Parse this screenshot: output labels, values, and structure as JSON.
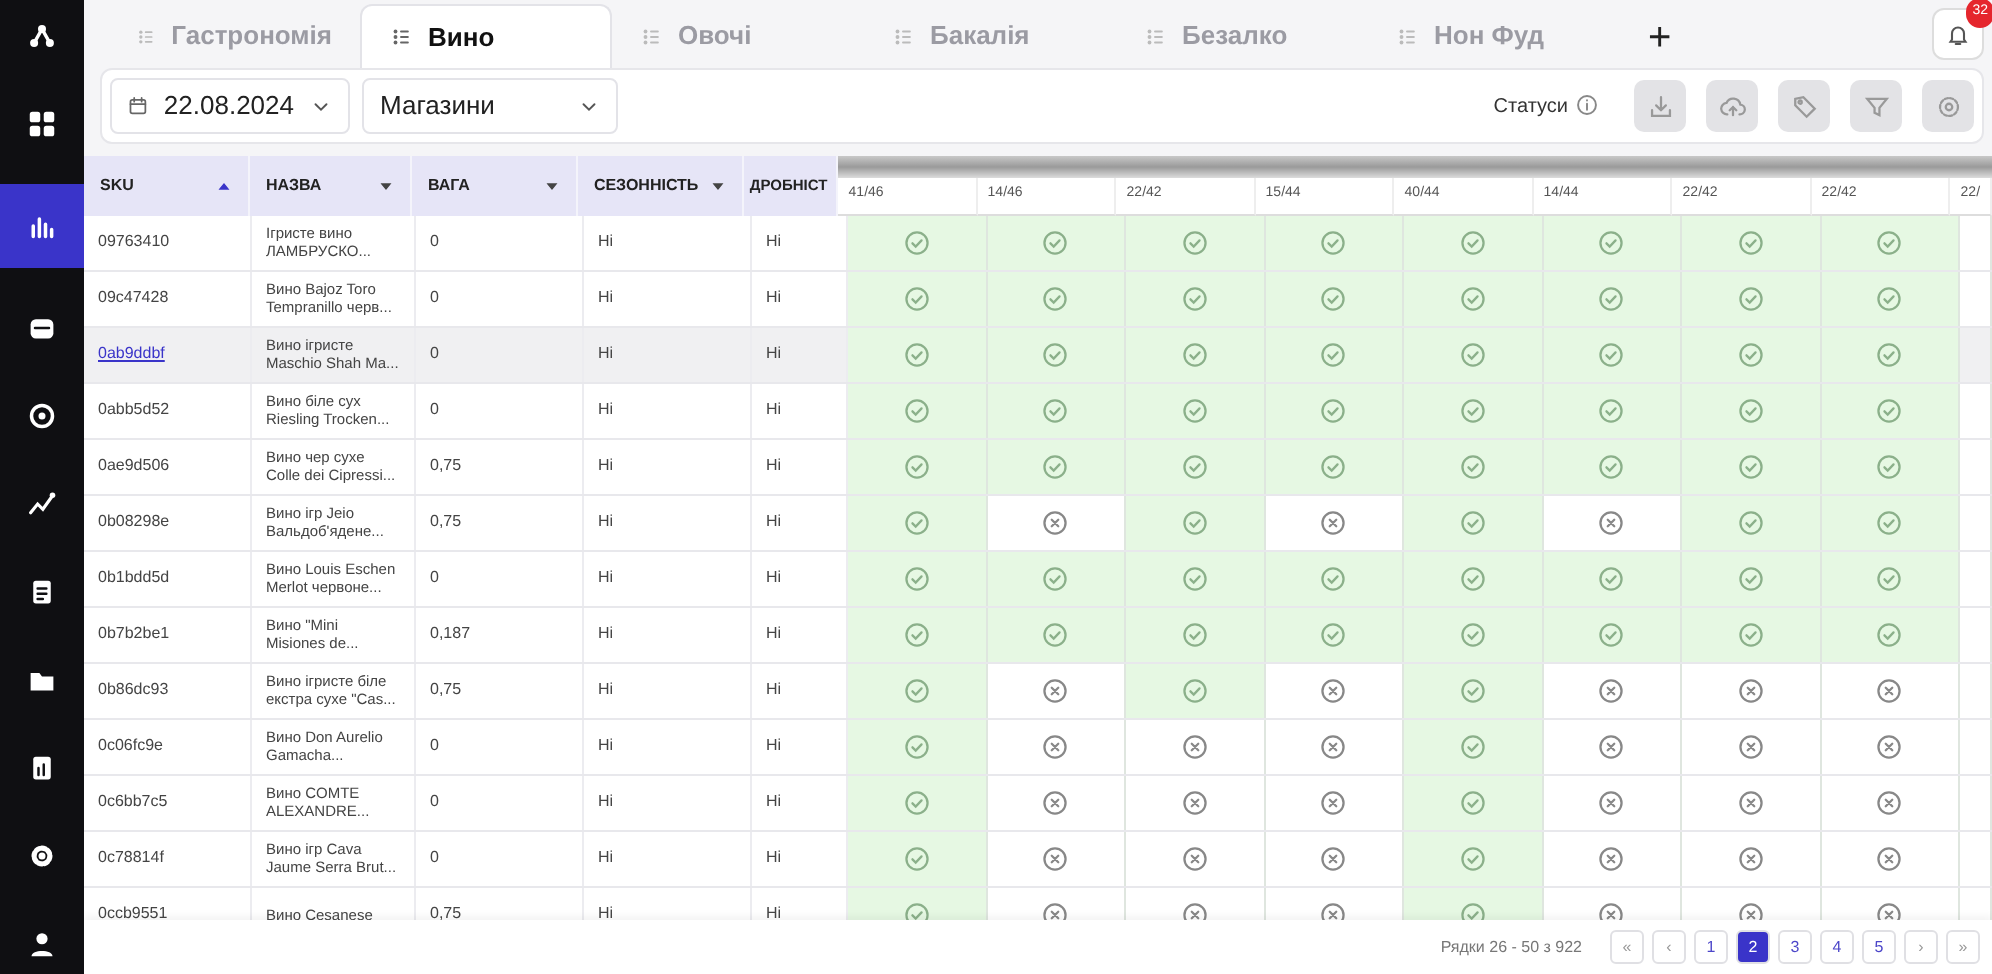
{
  "sidebar": {
    "items": [
      {
        "kind": "logo",
        "selected": false
      },
      {
        "kind": "grid",
        "selected": false
      },
      {
        "kind": "chart",
        "selected": true
      },
      {
        "kind": "box",
        "selected": false
      },
      {
        "kind": "target",
        "selected": false
      },
      {
        "kind": "trend",
        "selected": false
      },
      {
        "kind": "doc",
        "selected": false
      },
      {
        "kind": "folder",
        "selected": false
      },
      {
        "kind": "report",
        "selected": false
      },
      {
        "kind": "gear",
        "selected": false
      },
      {
        "kind": "user",
        "selected": false
      }
    ]
  },
  "tabs": [
    {
      "label": "Гастрономія",
      "selected": false
    },
    {
      "label": "Вино",
      "selected": true
    },
    {
      "label": "Овочі",
      "selected": false
    },
    {
      "label": "Бакалія",
      "selected": false
    },
    {
      "label": "Безалко",
      "selected": false
    },
    {
      "label": "Нон Фуд",
      "selected": false
    }
  ],
  "add_tab": "+",
  "notifications": {
    "count": "32"
  },
  "toolbar": {
    "date": "22.08.2024",
    "stores": "Магазини",
    "statuses_label": "Статуси",
    "actions": [
      {
        "kind": "download"
      },
      {
        "kind": "upload"
      },
      {
        "kind": "tag"
      },
      {
        "kind": "filter"
      },
      {
        "kind": "settings"
      }
    ]
  },
  "table": {
    "columns": [
      {
        "label": "SKU",
        "kind": "sorted"
      },
      {
        "label": "НАЗВА",
        "kind": "sortable"
      },
      {
        "label": "ВАГА",
        "kind": "sortable"
      },
      {
        "label": "СЕЗОННІСТЬ",
        "kind": "sortable"
      },
      {
        "label": "ДРОБНІСТ",
        "kind": "plain"
      }
    ],
    "status_columns": [
      "41/46",
      "14/46",
      "22/42",
      "15/44",
      "40/44",
      "14/44",
      "22/42",
      "22/42"
    ],
    "partial_column": "22/",
    "rows": [
      {
        "sku": "09763410",
        "name": "Ігристе вино ЛАМБРУСКО...",
        "weight": "0",
        "season": "Ні",
        "fraction": "Ні",
        "hovered": false,
        "statuses": [
          true,
          true,
          true,
          true,
          true,
          true,
          true,
          true
        ]
      },
      {
        "sku": "09c47428",
        "name": "Вино Bajoz Toro Tempranillo черв...",
        "weight": "0",
        "season": "Ні",
        "fraction": "Ні",
        "hovered": false,
        "statuses": [
          true,
          true,
          true,
          true,
          true,
          true,
          true,
          true
        ]
      },
      {
        "sku": "0ab9ddbf",
        "name": "Вино ігристе Maschio Shah Ma...",
        "weight": "0",
        "season": "Ні",
        "fraction": "Ні",
        "hovered": true,
        "statuses": [
          true,
          true,
          true,
          true,
          true,
          true,
          true,
          true
        ]
      },
      {
        "sku": "0abb5d52",
        "name": "Вино біле сух Riesling Trocken...",
        "weight": "0",
        "season": "Ні",
        "fraction": "Ні",
        "hovered": false,
        "statuses": [
          true,
          true,
          true,
          true,
          true,
          true,
          true,
          true
        ]
      },
      {
        "sku": "0ae9d506",
        "name": "Вино чер сухе Colle dei Cipressi...",
        "weight": "0,75",
        "season": "Ні",
        "fraction": "Ні",
        "hovered": false,
        "statuses": [
          true,
          true,
          true,
          true,
          true,
          true,
          true,
          true
        ]
      },
      {
        "sku": "0b08298e",
        "name": "Вино ігр Jeio Вальдоб'ядене...",
        "weight": "0,75",
        "season": "Ні",
        "fraction": "Ні",
        "hovered": false,
        "statuses": [
          true,
          false,
          true,
          false,
          true,
          false,
          true,
          true
        ]
      },
      {
        "sku": "0b1bdd5d",
        "name": "Вино Louis Eschen Merlot червоне...",
        "weight": "0",
        "season": "Ні",
        "fraction": "Ні",
        "hovered": false,
        "statuses": [
          true,
          true,
          true,
          true,
          true,
          true,
          true,
          true
        ]
      },
      {
        "sku": "0b7b2be1",
        "name": "Вино \"Mini Misiones de...",
        "weight": "0,187",
        "season": "Ні",
        "fraction": "Ні",
        "hovered": false,
        "statuses": [
          true,
          true,
          true,
          true,
          true,
          true,
          true,
          true
        ]
      },
      {
        "sku": "0b86dc93",
        "name": "Вино ігристе біле екстра сухе \"Cas...",
        "weight": "0,75",
        "season": "Ні",
        "fraction": "Ні",
        "hovered": false,
        "statuses": [
          true,
          false,
          true,
          false,
          true,
          false,
          false,
          false
        ]
      },
      {
        "sku": "0c06fc9e",
        "name": "Вино Don Aurelio Gamacha...",
        "weight": "0",
        "season": "Ні",
        "fraction": "Ні",
        "hovered": false,
        "statuses": [
          true,
          false,
          false,
          false,
          true,
          false,
          false,
          false
        ]
      },
      {
        "sku": "0c6bb7c5",
        "name": "Вино COMTE ALEXANDRE...",
        "weight": "0",
        "season": "Ні",
        "fraction": "Ні",
        "hovered": false,
        "statuses": [
          true,
          false,
          false,
          false,
          true,
          false,
          false,
          false
        ]
      },
      {
        "sku": "0c78814f",
        "name": "Вино ігр Cava Jaume Serra Brut...",
        "weight": "0",
        "season": "Ні",
        "fraction": "Ні",
        "hovered": false,
        "statuses": [
          true,
          false,
          false,
          false,
          true,
          false,
          false,
          false
        ]
      },
      {
        "sku": "0ccb9551",
        "name": "Вино Cesanese",
        "weight": "0,75",
        "season": "Ні",
        "fraction": "Ні",
        "hovered": false,
        "statuses": [
          true,
          false,
          false,
          false,
          true,
          false,
          false,
          false
        ]
      }
    ]
  },
  "pagination": {
    "summary": "Рядки 26 - 50 з 922",
    "first": "«",
    "prev": "‹",
    "pages": [
      {
        "label": "1",
        "selected": false
      },
      {
        "label": "2",
        "selected": true
      },
      {
        "label": "3",
        "selected": false
      },
      {
        "label": "4",
        "selected": false
      },
      {
        "label": "5",
        "selected": false
      }
    ],
    "next": "›",
    "last": "»"
  }
}
